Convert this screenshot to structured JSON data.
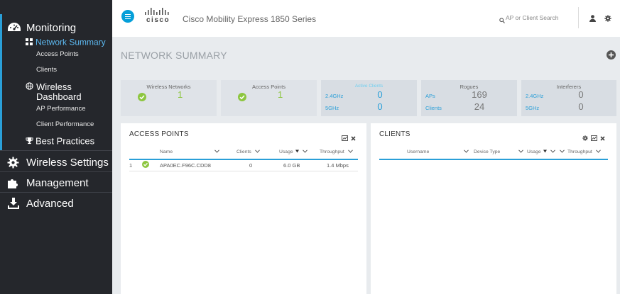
{
  "header": {
    "logo_text": "cisco",
    "app_title": "Cisco Mobility Express 1850 Series",
    "search_placeholder": "AP or Client Search"
  },
  "sidebar": {
    "monitoring": "Monitoring",
    "network_summary": "Network Summary",
    "access_points": "Access Points",
    "clients": "Clients",
    "wireless_dashboard": "Wireless Dashboard",
    "ap_performance": "AP Performance",
    "client_performance": "Client Performance",
    "best_practices": "Best Practices",
    "wireless_settings": "Wireless Settings",
    "management": "Management",
    "advanced": "Advanced"
  },
  "page": {
    "title": "NETWORK SUMMARY"
  },
  "cards": {
    "wireless_networks": {
      "title": "Wireless Networks",
      "value": "1"
    },
    "access_points": {
      "title": "Access Points",
      "value": "1"
    },
    "active_clients": {
      "title": "Active Clients",
      "label_24": "2.4GHz",
      "value_24": "0",
      "label_5": "5GHz",
      "value_5": "0"
    },
    "rogues": {
      "title": "Rogues",
      "label_aps": "APs",
      "value_aps": "169",
      "label_clients": "Clients",
      "value_clients": "24"
    },
    "interferers": {
      "title": "Interferers",
      "label_24": "2.4GHz",
      "value_24": "0",
      "label_5": "5GHz",
      "value_5": "0"
    }
  },
  "access_points_panel": {
    "title": "ACCESS POINTS",
    "columns": [
      "Name",
      "Clients",
      "Usage",
      "Throughput"
    ],
    "rows": [
      {
        "index": "1",
        "name": "APA0EC.F96C.CDD8",
        "clients": "0",
        "usage": "6.0 GB",
        "throughput": "1.4 Mbps"
      }
    ]
  },
  "clients_panel": {
    "title": "CLIENTS",
    "columns": [
      "Username",
      "Device Type",
      "Usage",
      "Throughput"
    ]
  },
  "colors": {
    "sidebar_bg": "#25272c",
    "accent_blue": "#2a9fd8",
    "status_green": "#8dc63f"
  }
}
